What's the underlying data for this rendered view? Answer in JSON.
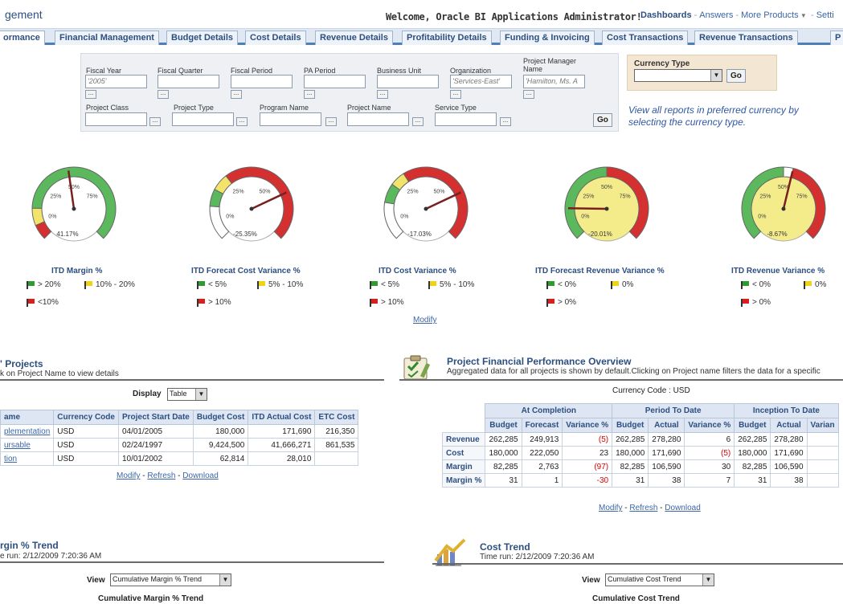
{
  "header": {
    "app_title": "gement",
    "welcome": "Welcome, Oracle BI Applications Administrator!",
    "links": {
      "dashboards": "Dashboards",
      "answers": "Answers",
      "more_products": "More Products",
      "settings": "Setti"
    }
  },
  "tabs": [
    {
      "label": "ormance"
    },
    {
      "label": "Financial Management"
    },
    {
      "label": "Budget Details"
    },
    {
      "label": "Cost Details"
    },
    {
      "label": "Revenue Details"
    },
    {
      "label": "Profitability Details"
    },
    {
      "label": "Funding & Invoicing"
    },
    {
      "label": "Cost Transactions"
    },
    {
      "label": "Revenue Transactions"
    },
    {
      "label": "P"
    }
  ],
  "filters": {
    "fiscal_year": {
      "label": "Fiscal Year",
      "value": "'2005'"
    },
    "fiscal_quarter": {
      "label": "Fiscal Quarter",
      "value": ""
    },
    "fiscal_period": {
      "label": "Fiscal Period",
      "value": ""
    },
    "pa_period": {
      "label": "PA Period",
      "value": ""
    },
    "business_unit": {
      "label": "Business Unit",
      "value": ""
    },
    "organization": {
      "label": "Organization",
      "value": "'Services-East'"
    },
    "project_manager": {
      "label1": "Project Manager",
      "label2": "Name",
      "value": "'Hamilton, Ms. A"
    },
    "project_class": {
      "label": "Project Class",
      "value": ""
    },
    "project_type": {
      "label": "Project Type",
      "value": ""
    },
    "program_name": {
      "label": "Program Name",
      "value": ""
    },
    "project_name": {
      "label": "Project Name",
      "value": ""
    },
    "service_type": {
      "label": "Service Type",
      "value": ""
    },
    "browse": "...",
    "go": "Go"
  },
  "currency": {
    "label": "Currency Type",
    "go": "Go",
    "help": "View all reports in preferred currency by selecting the currency type."
  },
  "gauges": [
    {
      "title": "ITD Margin %",
      "value_label": "41.17%",
      "value": 41.17,
      "ticks": [
        "0%",
        "25%",
        "50%",
        "75%"
      ],
      "legend": [
        {
          "color": "g",
          "text": "> 20%"
        },
        {
          "color": "y",
          "text": "10% - 20%"
        },
        {
          "color": "r",
          "text": "<10%"
        }
      ]
    },
    {
      "title": "ITD Forecat Cost Variance %",
      "value_label": "-25.35%",
      "value": -25.35,
      "ticks": [
        "0%",
        "25%",
        "50%"
      ],
      "legend": [
        {
          "color": "g",
          "text": "< 5%"
        },
        {
          "color": "y",
          "text": "5% - 10%"
        },
        {
          "color": "r",
          "text": "> 10%"
        }
      ]
    },
    {
      "title": "ITD Cost Variance %",
      "value_label": "-17.03%",
      "value": -17.03,
      "ticks": [
        "0%",
        "25%",
        "50%"
      ],
      "legend": [
        {
          "color": "g",
          "text": "< 5%"
        },
        {
          "color": "y",
          "text": "5% - 10%"
        },
        {
          "color": "r",
          "text": "> 10%"
        }
      ]
    },
    {
      "title": "ITD Forecast Revenue Variance %",
      "value_label": "-20.01%",
      "value": -20.01,
      "ticks": [
        "0%",
        "25%",
        "50%",
        "75%"
      ],
      "legend": [
        {
          "color": "g",
          "text": "< 0%"
        },
        {
          "color": "y",
          "text": "0%"
        },
        {
          "color": "r",
          "text": "> 0%"
        }
      ]
    },
    {
      "title": "ITD Revenue Variance %",
      "value_label": "-8.67%",
      "value": -8.67,
      "ticks": [
        "0%",
        "25%",
        "50%",
        "75%"
      ],
      "legend": [
        {
          "color": "g",
          "text": "< 0%"
        },
        {
          "color": "y",
          "text": "0%"
        },
        {
          "color": "r",
          "text": "> 0%"
        }
      ]
    }
  ],
  "gauge_modify": "Modify",
  "projects": {
    "title": "Projects",
    "subtitle": "k on Project Name to view details",
    "display_label": "Display",
    "display_value": "Table",
    "columns": [
      "ame",
      "Currency Code",
      "Project Start Date",
      "Budget Cost",
      "ITD Actual Cost",
      "ETC Cost"
    ],
    "rows": [
      [
        "plementation",
        "USD",
        "04/01/2005",
        "180,000",
        "171,690",
        "216,350"
      ],
      [
        "ursable",
        "USD",
        "02/24/1997",
        "9,424,500",
        "41,666,271",
        "861,535"
      ],
      [
        "tion",
        "USD",
        "10/01/2002",
        "62,814",
        "28,010",
        ""
      ]
    ],
    "links": {
      "modify": "Modify",
      "refresh": "Refresh",
      "download": "Download",
      "sep": "-"
    }
  },
  "overview": {
    "title": "Project Financial Performance Overview",
    "subtitle": "Aggregated data for all projects is shown by default.Clicking on Project name filters the data for a specific",
    "currency_code": "Currency Code : USD",
    "groups": [
      "At Completion",
      "Period To Date",
      "Inception To Date"
    ],
    "columns": [
      "Budget",
      "Forecast",
      "Variance %",
      "Budget",
      "Actual",
      "Variance %",
      "Budget",
      "Actual",
      "Varian"
    ],
    "rows": [
      {
        "label": "Revenue",
        "cells": [
          "262,285",
          "249,913",
          "(5)",
          "262,285",
          "278,280",
          "6",
          "262,285",
          "278,280",
          ""
        ]
      },
      {
        "label": "Cost",
        "cells": [
          "180,000",
          "222,050",
          "23",
          "180,000",
          "171,690",
          "(5)",
          "180,000",
          "171,690",
          ""
        ]
      },
      {
        "label": "Margin",
        "cells": [
          "82,285",
          "2,763",
          "(97)",
          "82,285",
          "106,590",
          "30",
          "82,285",
          "106,590",
          ""
        ]
      },
      {
        "label": "Margin %",
        "cells": [
          "31",
          "1",
          "-30",
          "31",
          "38",
          "7",
          "31",
          "38",
          ""
        ]
      }
    ],
    "links": {
      "modify": "Modify",
      "refresh": "Refresh",
      "download": "Download",
      "sep": "-"
    }
  },
  "margin_trend": {
    "title": "rgin % Trend",
    "time_run": "e run: 2/12/2009 7:20:36 AM",
    "view_label": "View",
    "view_value": "Cumulative Margin % Trend",
    "chart_title": "Cumulative Margin % Trend"
  },
  "cost_trend": {
    "title": "Cost Trend",
    "time_run": "Time run: 2/12/2009 7:20:36 AM",
    "view_label": "View",
    "view_value": "Cumulative Cost Trend",
    "chart_title": "Cumulative Cost Trend"
  },
  "colors": {
    "accent": "#2c4f80",
    "link": "#3a66a8",
    "gauge_green": "#5cb85c",
    "gauge_yellow": "#f2e46b",
    "gauge_red": "#d43030"
  }
}
